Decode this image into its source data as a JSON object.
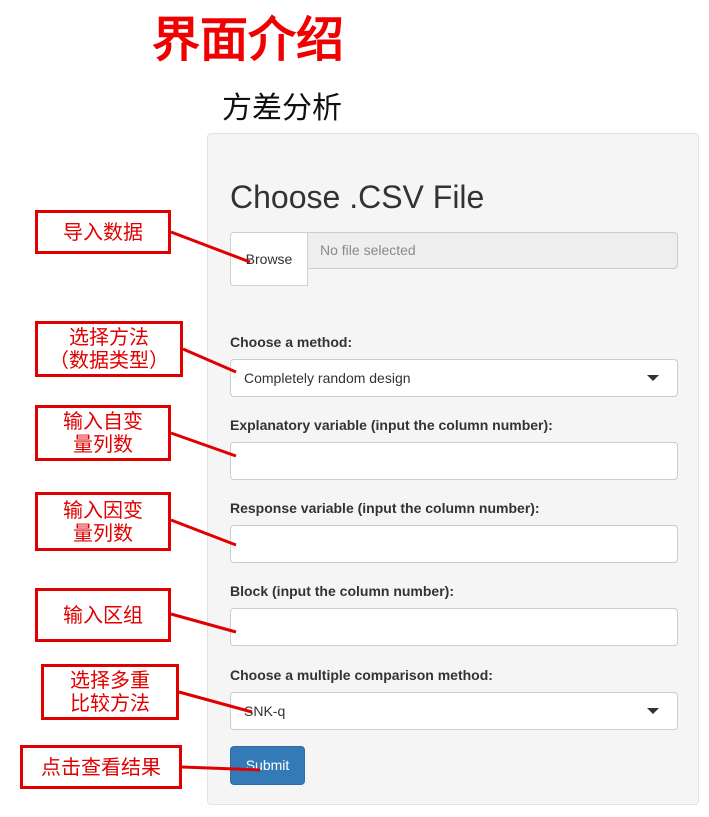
{
  "page": {
    "title": "界面介绍",
    "subtitle": "方差分析"
  },
  "form": {
    "heading": "Choose .CSV File",
    "file": {
      "browse_label": "Browse",
      "status_text": "No file selected"
    },
    "method": {
      "label": "Choose a method:",
      "selected": "Completely random design"
    },
    "explanatory": {
      "label": "Explanatory variable (input the column number):",
      "value": ""
    },
    "response": {
      "label": "Response variable (input the column number):",
      "value": ""
    },
    "block": {
      "label": "Block (input the column number):",
      "value": ""
    },
    "comparison": {
      "label": "Choose a multiple comparison method:",
      "selected": "SNK-q"
    },
    "submit_label": "Submit"
  },
  "annotations": {
    "import": "导入数据",
    "method": {
      "line1": "选择方法",
      "line2": "（数据类型）"
    },
    "explanatory": {
      "line1": "输入自变",
      "line2": "量列数"
    },
    "response": {
      "line1": "输入因变",
      "line2": "量列数"
    },
    "block": "输入区组",
    "comparison": {
      "line1": "选择多重",
      "line2": "比较方法"
    },
    "submit": "点击查看结果"
  },
  "colors": {
    "annotation_red": "#e00000",
    "title_red": "#f00000",
    "submit_blue": "#337ab7",
    "panel_bg": "#f5f5f5"
  }
}
